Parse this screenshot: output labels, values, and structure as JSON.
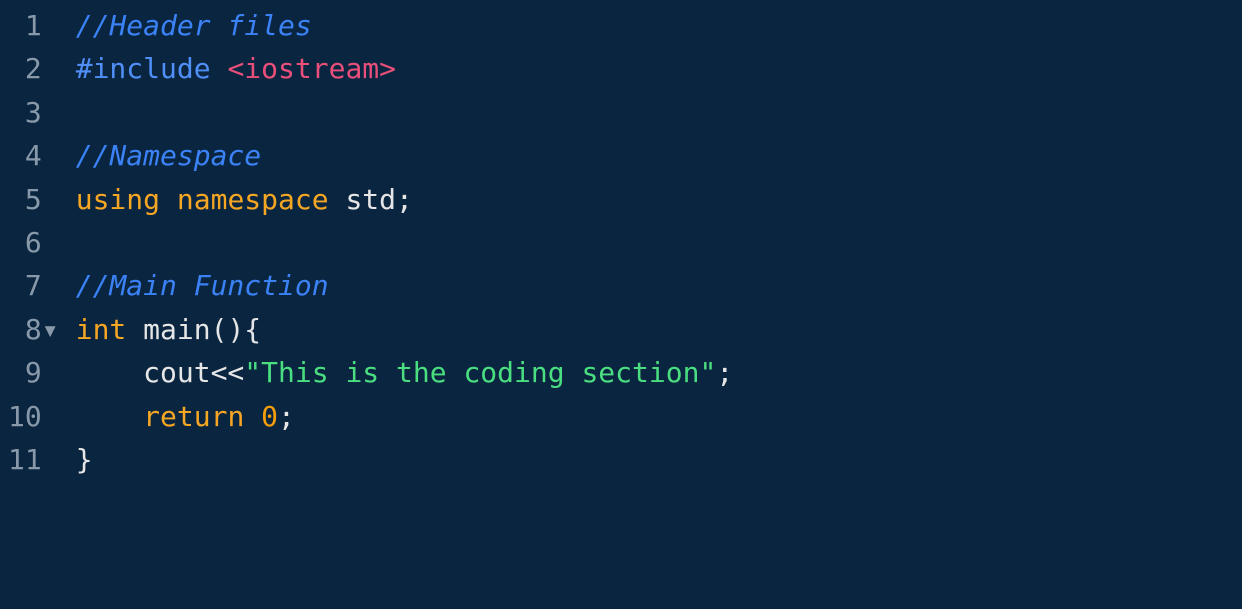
{
  "editor": {
    "lineStart": 1,
    "foldLine": 8,
    "lines": [
      {
        "num": "1",
        "tokens": [
          {
            "cls": "comment",
            "text": "//Header files"
          }
        ]
      },
      {
        "num": "2",
        "tokens": [
          {
            "cls": "kw-blue",
            "text": "#include "
          },
          {
            "cls": "include",
            "text": "<iostream>"
          }
        ]
      },
      {
        "num": "3",
        "tokens": [
          {
            "cls": "plain",
            "text": ""
          }
        ]
      },
      {
        "num": "4",
        "tokens": [
          {
            "cls": "comment",
            "text": "//Namespace"
          }
        ]
      },
      {
        "num": "5",
        "tokens": [
          {
            "cls": "keyword",
            "text": "using"
          },
          {
            "cls": "plain",
            "text": " "
          },
          {
            "cls": "keyword",
            "text": "namespace"
          },
          {
            "cls": "plain",
            "text": " std;"
          }
        ]
      },
      {
        "num": "6",
        "tokens": [
          {
            "cls": "plain",
            "text": ""
          }
        ]
      },
      {
        "num": "7",
        "tokens": [
          {
            "cls": "comment",
            "text": "//Main Function"
          }
        ]
      },
      {
        "num": "8",
        "tokens": [
          {
            "cls": "type",
            "text": "int"
          },
          {
            "cls": "plain",
            "text": " main(){"
          }
        ]
      },
      {
        "num": "9",
        "tokens": [
          {
            "cls": "plain",
            "text": "    cout<<"
          },
          {
            "cls": "string",
            "text": "\"This is the coding section\""
          },
          {
            "cls": "plain",
            "text": ";"
          }
        ]
      },
      {
        "num": "10",
        "tokens": [
          {
            "cls": "plain",
            "text": "    "
          },
          {
            "cls": "keyword",
            "text": "return"
          },
          {
            "cls": "plain",
            "text": " "
          },
          {
            "cls": "number",
            "text": "0"
          },
          {
            "cls": "plain",
            "text": ";"
          }
        ]
      },
      {
        "num": "11",
        "tokens": [
          {
            "cls": "plain",
            "text": "}"
          }
        ]
      }
    ],
    "foldGlyph": "▾"
  }
}
